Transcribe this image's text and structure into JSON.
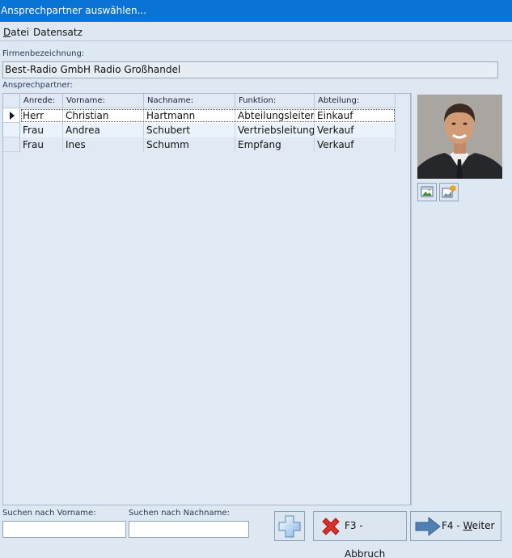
{
  "window": {
    "title": "Ansprechpartner auswählen..."
  },
  "menu": {
    "items": [
      {
        "prefix": "D",
        "rest": "atei"
      },
      {
        "prefix": "",
        "rest": "Datensatz"
      }
    ]
  },
  "company": {
    "label": "Firmenbezeichnung:",
    "value": "Best-Radio GmbH Radio Großhandel"
  },
  "contacts": {
    "label": "Ansprechpartner:",
    "columns": [
      "Anrede:",
      "Vorname:",
      "Nachname:",
      "Funktion:",
      "Abteilung:"
    ],
    "rows": [
      [
        "Herr",
        "Christian",
        "Hartmann",
        "Abteilungsleiter",
        "Einkauf"
      ],
      [
        "Frau",
        "Andrea",
        "Schubert",
        "Vertriebsleitung",
        "Verkauf"
      ],
      [
        "Frau",
        "Ines",
        "Schumm",
        "Empfang",
        "Verkauf"
      ]
    ],
    "selected_row": 0
  },
  "search": {
    "first_name_label": "Suchen nach Vorname:",
    "last_name_label": "Suchen nach Nachname:",
    "first_name_value": "",
    "last_name_value": ""
  },
  "buttons": {
    "cancel": {
      "key": "F3 - ",
      "u": "A",
      "rest": "bbruch"
    },
    "next": {
      "key": "F4 - ",
      "u": "W",
      "rest": "eiter"
    }
  },
  "icons": {
    "add": "plus-icon",
    "cancel": "red-x-icon",
    "next": "arrow-right-icon",
    "photo_load": "image-load-icon",
    "photo_edit": "image-edit-icon"
  },
  "colors": {
    "titlebar": "#0a74d6",
    "background": "#dde8f3",
    "selected_row": "#ffffff",
    "alt_row": "#eaf2fb"
  }
}
